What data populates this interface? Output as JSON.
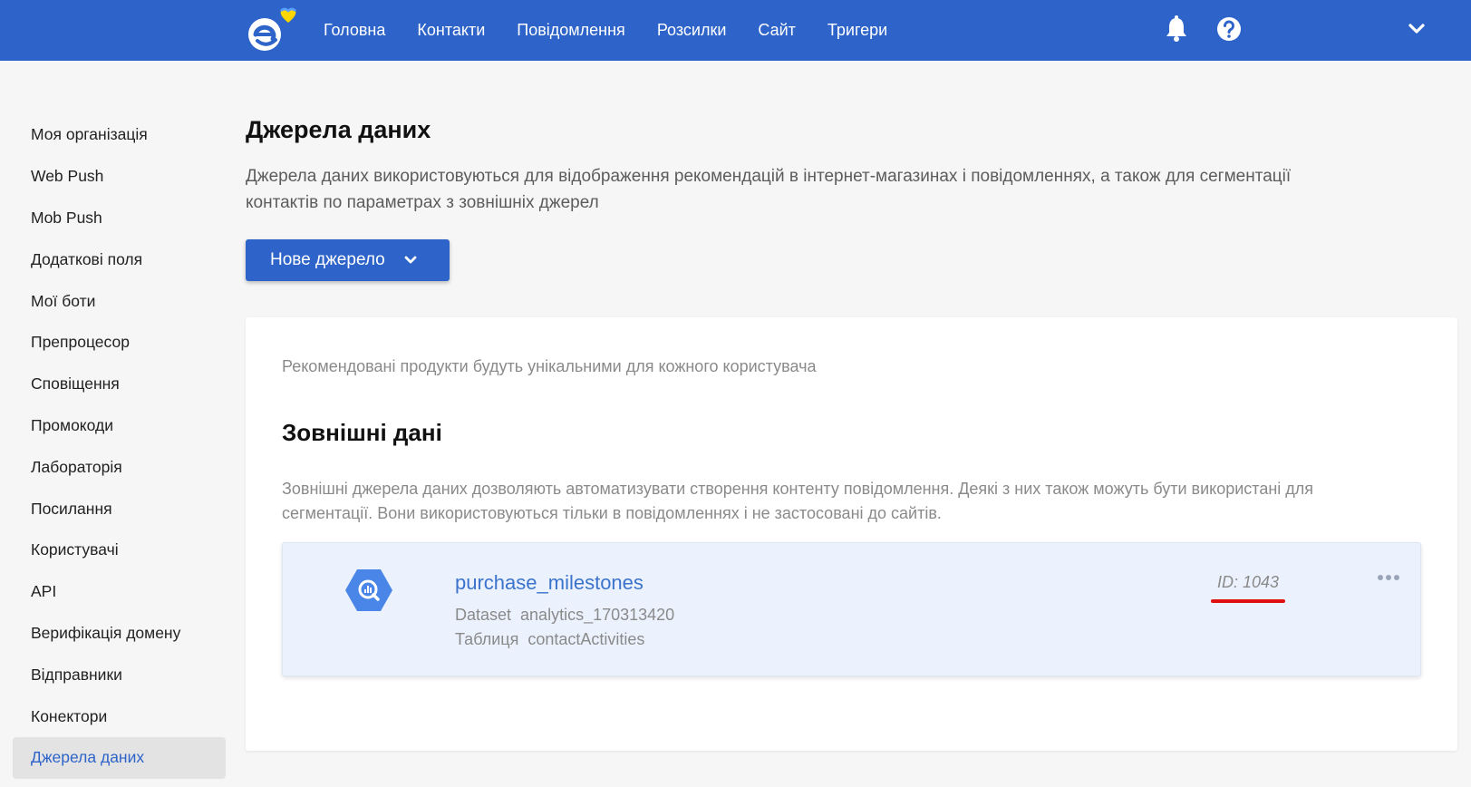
{
  "header": {
    "logo_icon": "esputnik-logo-icon",
    "nav": [
      "Головна",
      "Контакти",
      "Повідомлення",
      "Розсилки",
      "Сайт",
      "Тригери"
    ],
    "icons": [
      "bell-icon",
      "help-icon",
      "chevron-down-icon"
    ],
    "background_color": "#2e64c9"
  },
  "sidebar": {
    "items": [
      {
        "label": "Моя організація"
      },
      {
        "label": "Web Push"
      },
      {
        "label": "Mob Push"
      },
      {
        "label": "Додаткові поля"
      },
      {
        "label": "Мої боти"
      },
      {
        "label": "Препроцесор"
      },
      {
        "label": "Сповіщення"
      },
      {
        "label": "Промокоди"
      },
      {
        "label": "Лабораторія"
      },
      {
        "label": "Посилання"
      },
      {
        "label": "Користувачі"
      },
      {
        "label": "API"
      },
      {
        "label": "Верифікація домену"
      },
      {
        "label": "Відправники"
      },
      {
        "label": "Конектори"
      },
      {
        "label": "Джерела даних"
      }
    ],
    "active_item": "Джерела даних"
  },
  "main": {
    "title": "Джерела даних",
    "description_line1": "Джерела даних використовуються для відображення рекомендацій в інтернет-магазинах і повідомленнях, а також для сегментації",
    "description_line2": "контактів по параметрах з зовнішніх джерел",
    "new_source_button": "Нове джерело",
    "card": {
      "recommendation_note": "Рекомендовані продукти будуть унікальними для кожного користувача",
      "external_title": "Зовнішні дані",
      "external_description_line1": "Зовнішні джерела даних дозволяють автоматизувати створення контенту повідомлення. Деякі з них також можуть бути використані для",
      "external_description_line2": "сегментації. Вони використовуються тільки в повідомленнях і не застосовані до сайтів.",
      "source": {
        "icon": "bigquery-icon",
        "name": "purchase_milestones",
        "dataset_line": "Dataset  analytics_170313420",
        "table_line": "Таблиця  contactActivities",
        "id": "ID: 1043",
        "menu_icon": "more-horizontal-icon"
      }
    }
  },
  "colors": {
    "accent": "#2e64c9",
    "link": "#3b73cc",
    "highlight_underline": "#e01010",
    "source_card_bg": "#ebf2fd"
  }
}
